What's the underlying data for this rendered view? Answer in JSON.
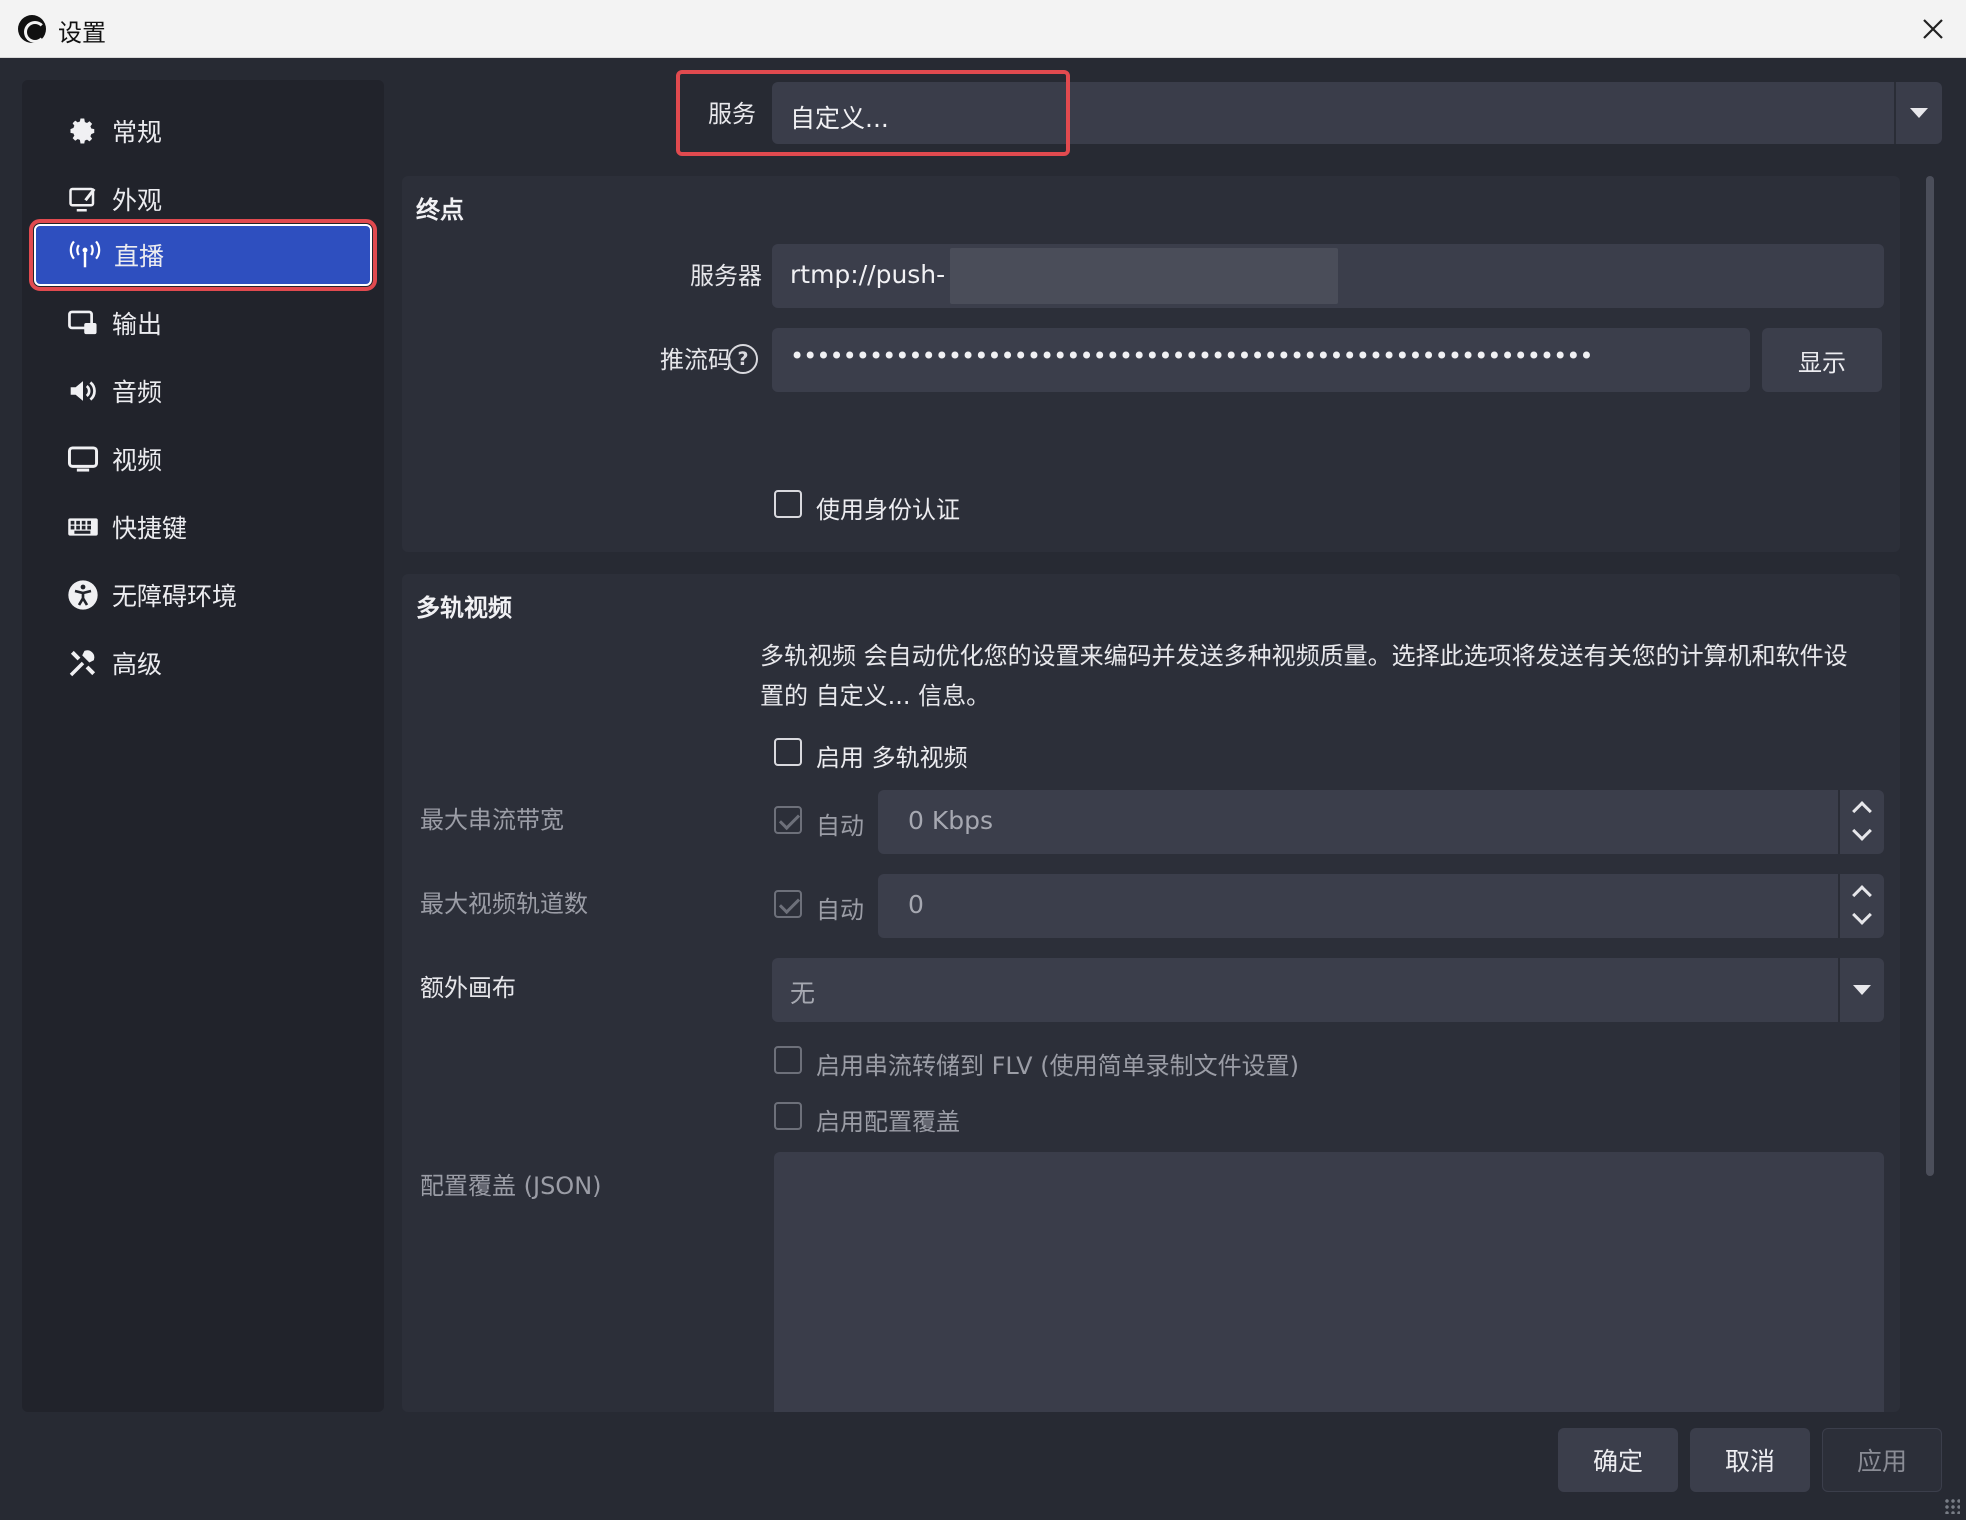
{
  "window": {
    "title": "设置"
  },
  "sidebar": {
    "items": [
      {
        "label": "常规",
        "icon": "gear-icon"
      },
      {
        "label": "外观",
        "icon": "appearance-icon"
      },
      {
        "label": "直播",
        "icon": "broadcast-icon",
        "active": true
      },
      {
        "label": "输出",
        "icon": "output-icon"
      },
      {
        "label": "音频",
        "icon": "speaker-icon"
      },
      {
        "label": "视频",
        "icon": "monitor-icon"
      },
      {
        "label": "快捷键",
        "icon": "keyboard-icon"
      },
      {
        "label": "无障碍环境",
        "icon": "accessibility-icon"
      },
      {
        "label": "高级",
        "icon": "tools-icon"
      }
    ]
  },
  "service": {
    "label": "服务",
    "value": "自定义..."
  },
  "endpoint": {
    "title": "终点",
    "server_label": "服务器",
    "server_value": "rtmp://push-",
    "key_label": "推流码",
    "key_value": "•••••••••••••••••••••••••••••••••••••••••••••••••••••••••••••",
    "show_button": "显示",
    "use_auth_label": "使用身份认证"
  },
  "multitrack": {
    "title": "多轨视频",
    "description": "多轨视频 会自动优化您的设置来编码并发送多种视频质量。选择此选项将发送有关您的计算机和软件设置的 自定义... 信息。",
    "enable_label": "启用 多轨视频",
    "max_bandwidth_label": "最大串流带宽",
    "max_bandwidth_auto": "自动",
    "max_bandwidth_value": "0 Kbps",
    "max_tracks_label": "最大视频轨道数",
    "max_tracks_auto": "自动",
    "max_tracks_value": "0",
    "extra_canvas_label": "额外画布",
    "extra_canvas_value": "无",
    "flv_label": "启用串流转储到 FLV (使用简单录制文件设置)",
    "config_override_label": "启用配置覆盖",
    "config_json_label": "配置覆盖 (JSON)"
  },
  "buttons": {
    "ok": "确定",
    "cancel": "取消",
    "apply": "应用"
  },
  "colors": {
    "accent": "#2e4fbf",
    "highlight": "#e14a4f",
    "panel": "#2c2f39",
    "field": "#3b3e4b"
  }
}
